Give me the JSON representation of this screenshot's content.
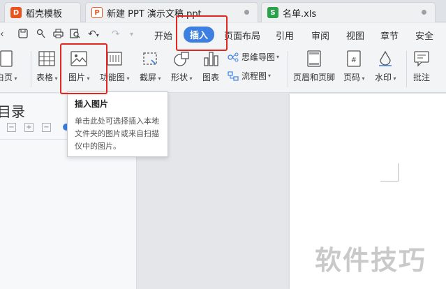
{
  "tabs": [
    {
      "label": "稻壳模板",
      "icon": "docer-icon",
      "color": "#e8531e"
    },
    {
      "label": "新建 PPT 演示文稿.ppt",
      "icon": "ppt-icon",
      "color": "#e8531e"
    },
    {
      "label": "名单.xls",
      "icon": "xls-icon",
      "color": "#2aa24b"
    }
  ],
  "menu": {
    "items": [
      "开始",
      "插入",
      "页面布局",
      "引用",
      "审阅",
      "视图",
      "章节",
      "安全"
    ],
    "active": "插入"
  },
  "toolbar": {
    "blank_page": "白页",
    "table": "表格",
    "picture": "图片",
    "function_chart": "功能图",
    "screenshot": "截屏",
    "shape": "形状",
    "chart": "图表",
    "mindmap": "思维导图",
    "flowchart": "流程图",
    "header_footer": "页眉和页脚",
    "page_number": "页码",
    "watermark": "水印",
    "comment": "批注"
  },
  "tooltip": {
    "title": "插入图片",
    "body": "单击此处可选择插入本地文件夹的图片或来自扫描仪中的图片。"
  },
  "left_panel": {
    "title": "目录"
  },
  "document": {
    "watermark_text": "软件技巧"
  },
  "colors": {
    "accent": "#3d7fe0",
    "highlight": "#e0281e"
  }
}
